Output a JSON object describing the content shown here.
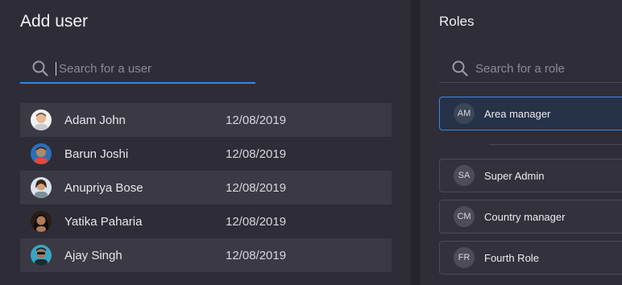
{
  "add_user": {
    "title": "Add user",
    "search_placeholder": "Search for a user",
    "users": [
      {
        "name": "Adam John",
        "date": "12/08/2019",
        "avatar_color": "#f1d7c3"
      },
      {
        "name": "Barun Joshi",
        "date": "12/08/2019",
        "avatar_color": "#2d6fb5"
      },
      {
        "name": "Anupriya Bose",
        "date": "12/08/2019",
        "avatar_color": "#d9e4ea"
      },
      {
        "name": "Yatika Paharia",
        "date": "12/08/2019",
        "avatar_color": "#2b1d18"
      },
      {
        "name": "Ajay Singh",
        "date": "12/08/2019",
        "avatar_color": "#3aa6c4"
      }
    ]
  },
  "roles": {
    "title": "Roles",
    "search_placeholder": "Search for a role",
    "items": [
      {
        "initials": "AM",
        "label": "Area manager",
        "selected": true
      },
      {
        "initials": "SA",
        "label": "Super Admin",
        "selected": false
      },
      {
        "initials": "CM",
        "label": "Country manager",
        "selected": false
      },
      {
        "initials": "FR",
        "label": "Fourth Role",
        "selected": false
      }
    ]
  },
  "colors": {
    "accent": "#3c86e0",
    "background": "#2b2a33"
  },
  "icons": {
    "search": "search-icon"
  }
}
